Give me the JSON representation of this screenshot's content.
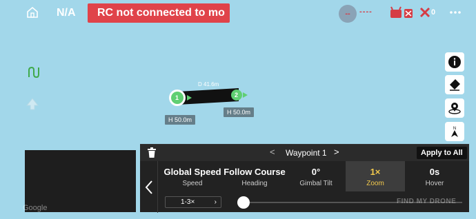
{
  "top_bar": {
    "flight_mode": "N/A",
    "banner": "RC not connected to mo",
    "signal": "--",
    "signal_bars": "- - - -",
    "satellite_count": "0",
    "colors": {
      "banner_bg": "#e0434a",
      "alert": "#d63c45"
    }
  },
  "icons": {
    "home": "home-icon",
    "more": "more-icon",
    "rc": "rc-icon",
    "satellite": "satellite-icon",
    "info": "info-icon",
    "eraser": "eraser-icon",
    "location": "location-icon",
    "north": "north-icon",
    "route": "route-icon",
    "takeoff": "takeoff-icon",
    "trash": "trash-icon"
  },
  "map": {
    "distance_label": "D 41.6m",
    "waypoints": [
      {
        "index": "1",
        "height_label": "H 50.0m"
      },
      {
        "index": "2",
        "height_label": "H 50.0m"
      }
    ]
  },
  "panel": {
    "prev": "<",
    "title": "Waypoint 1",
    "next": ">",
    "apply_label": "Apply to All",
    "params": [
      {
        "value": "Global Speed",
        "label": "Speed"
      },
      {
        "value": "Follow Course",
        "label": "Heading"
      },
      {
        "value": "0°",
        "label": "Gimbal Tilt"
      },
      {
        "value": "1×",
        "label": "Zoom"
      },
      {
        "value": "0s",
        "label": "Hover"
      }
    ],
    "zoom_range": "1-3×",
    "zoom_slider_level": 0
  },
  "watermark": "FIND MY DRONE",
  "watermark_left": "Google"
}
